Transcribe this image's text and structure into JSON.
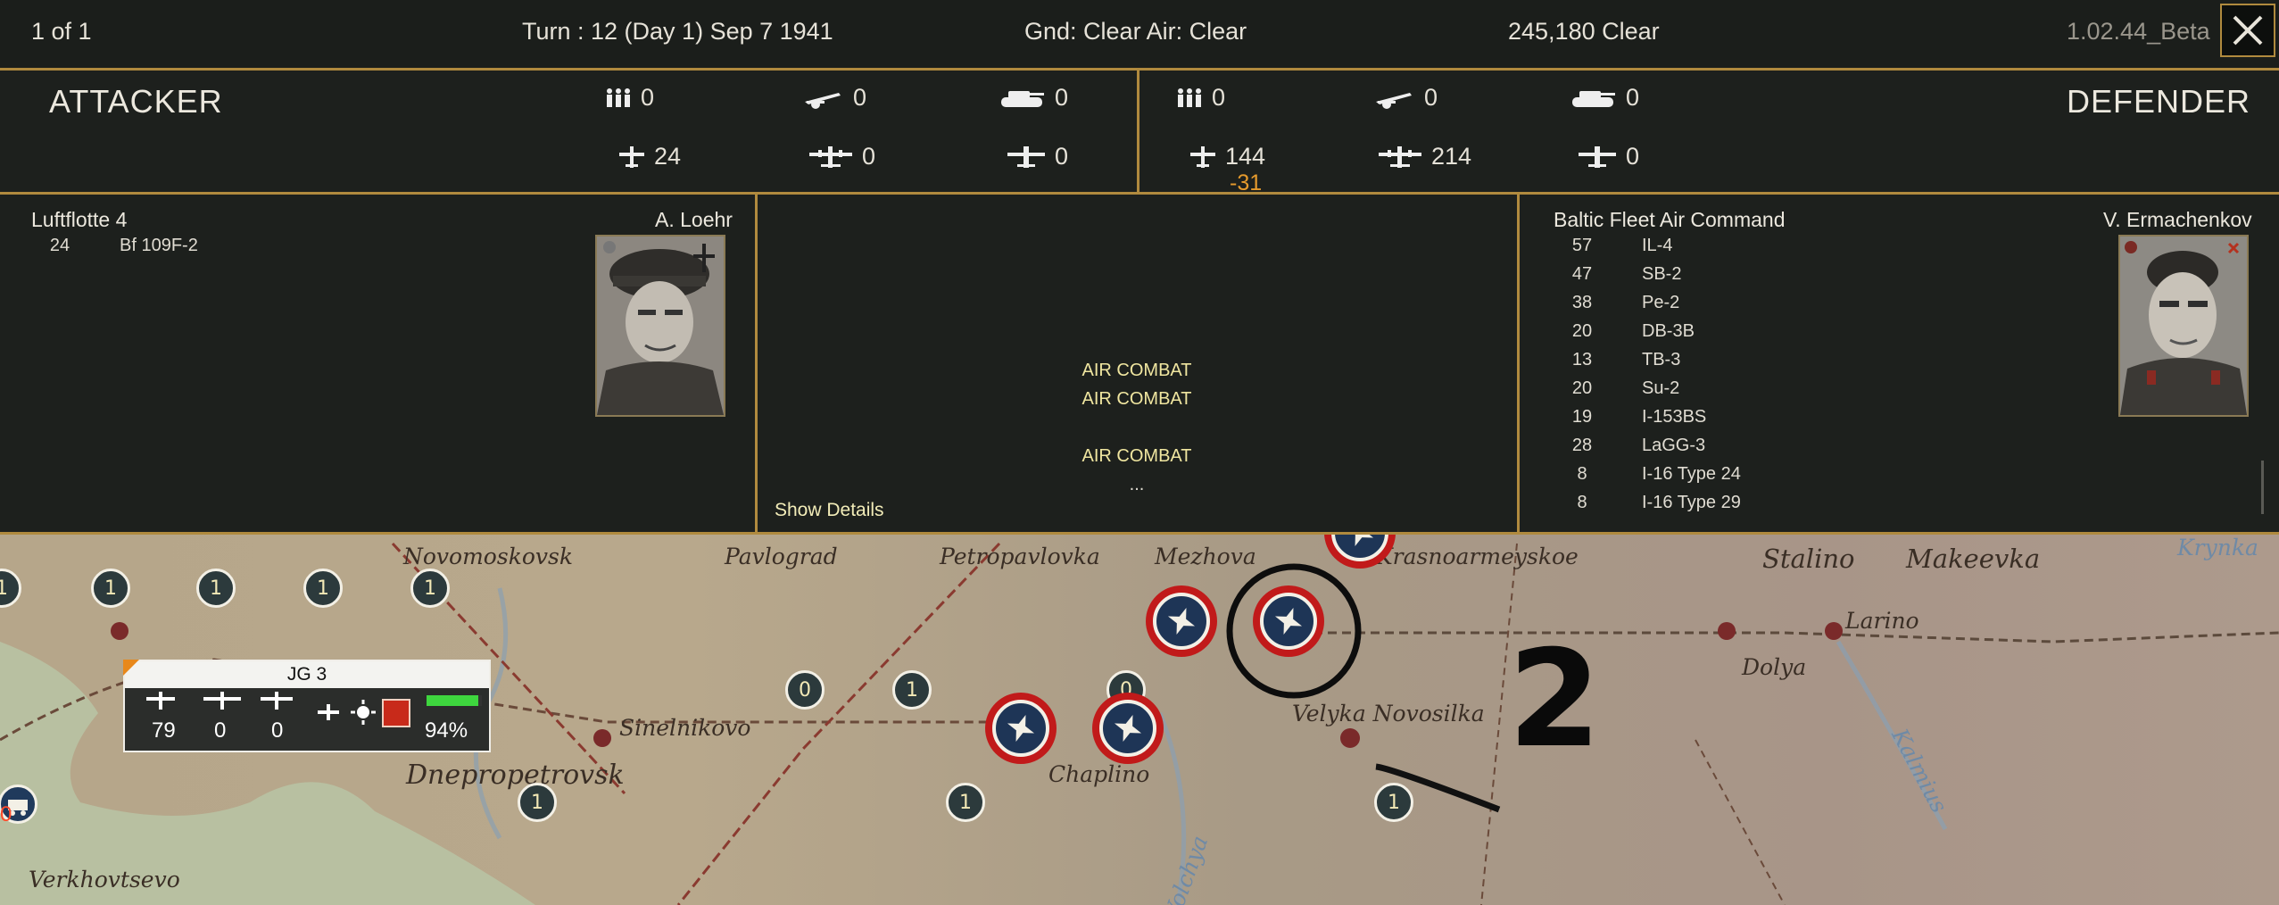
{
  "topbar": {
    "page": "1 of 1",
    "turn": "Turn : 12 (Day 1)   Sep 7 1941",
    "weather": "Gnd: Clear  Air: Clear",
    "location": "245,180   Clear",
    "version": "1.02.44_Beta"
  },
  "attacker": {
    "title": "ATTACKER",
    "men": "0",
    "guns": "0",
    "tanks": "0",
    "fighters": "24",
    "bombers": "0",
    "other_air": "0",
    "commander_unit": "Luftflotte 4",
    "leader": "A. Loehr",
    "units": [
      {
        "count": "24",
        "type": "Bf 109F-2"
      }
    ]
  },
  "defender": {
    "title": "DEFENDER",
    "men": "0",
    "guns": "0",
    "tanks": "0",
    "fighters": "144",
    "fighter_loss": "-31",
    "bombers": "214",
    "other_air": "0",
    "commander_unit": "Baltic Fleet Air Command",
    "leader": "V. Ermachenkov",
    "units": [
      {
        "count": "57",
        "type": "IL-4"
      },
      {
        "count": "47",
        "type": "SB-2"
      },
      {
        "count": "38",
        "type": "Pe-2"
      },
      {
        "count": "20",
        "type": "DB-3B"
      },
      {
        "count": "13",
        "type": "TB-3"
      },
      {
        "count": "20",
        "type": "Su-2"
      },
      {
        "count": "19",
        "type": "I-153BS"
      },
      {
        "count": "28",
        "type": "LaGG-3"
      },
      {
        "count": "8",
        "type": "I-16 Type 24"
      },
      {
        "count": "8",
        "type": "I-16 Type 29"
      }
    ]
  },
  "combat_log": {
    "line1": "AIR COMBAT",
    "line2": "AIR COMBAT",
    "line3": "AIR COMBAT",
    "ellipsis": "...",
    "show_details": "Show Details"
  },
  "map": {
    "cities": {
      "novomoskovsk": "Novomoskovsk",
      "pavlograd": "Pavlograd",
      "petropavlovka": "Petropavlovka",
      "mezhova": "Mezhova",
      "krasnoarmeyskoe": "Krasnoarmeyskoe",
      "stalino": "Stalino",
      "makeevka": "Makeevka",
      "larino": "Larino",
      "dolya": "Dolya",
      "sinelnikovo": "Sinelnikovo",
      "dnepropetrovsk": "Dnepropetrovsk",
      "chaplino": "Chaplino",
      "velyka": "Velyka Novosilka",
      "verkhovtsevo": "Verkhovtsevo",
      "kalmius": "Kalmius",
      "volchya": "Volchya",
      "krynka": "Krynka"
    },
    "marker_value": "1",
    "marker_zero": "0",
    "annotation": "2",
    "unit_panel": {
      "name": "JG 3",
      "fighters": "79",
      "bombers": "0",
      "other": "0",
      "readiness": "94%",
      "readiness_fraction": 0.94
    },
    "left_marker_value": "0"
  }
}
